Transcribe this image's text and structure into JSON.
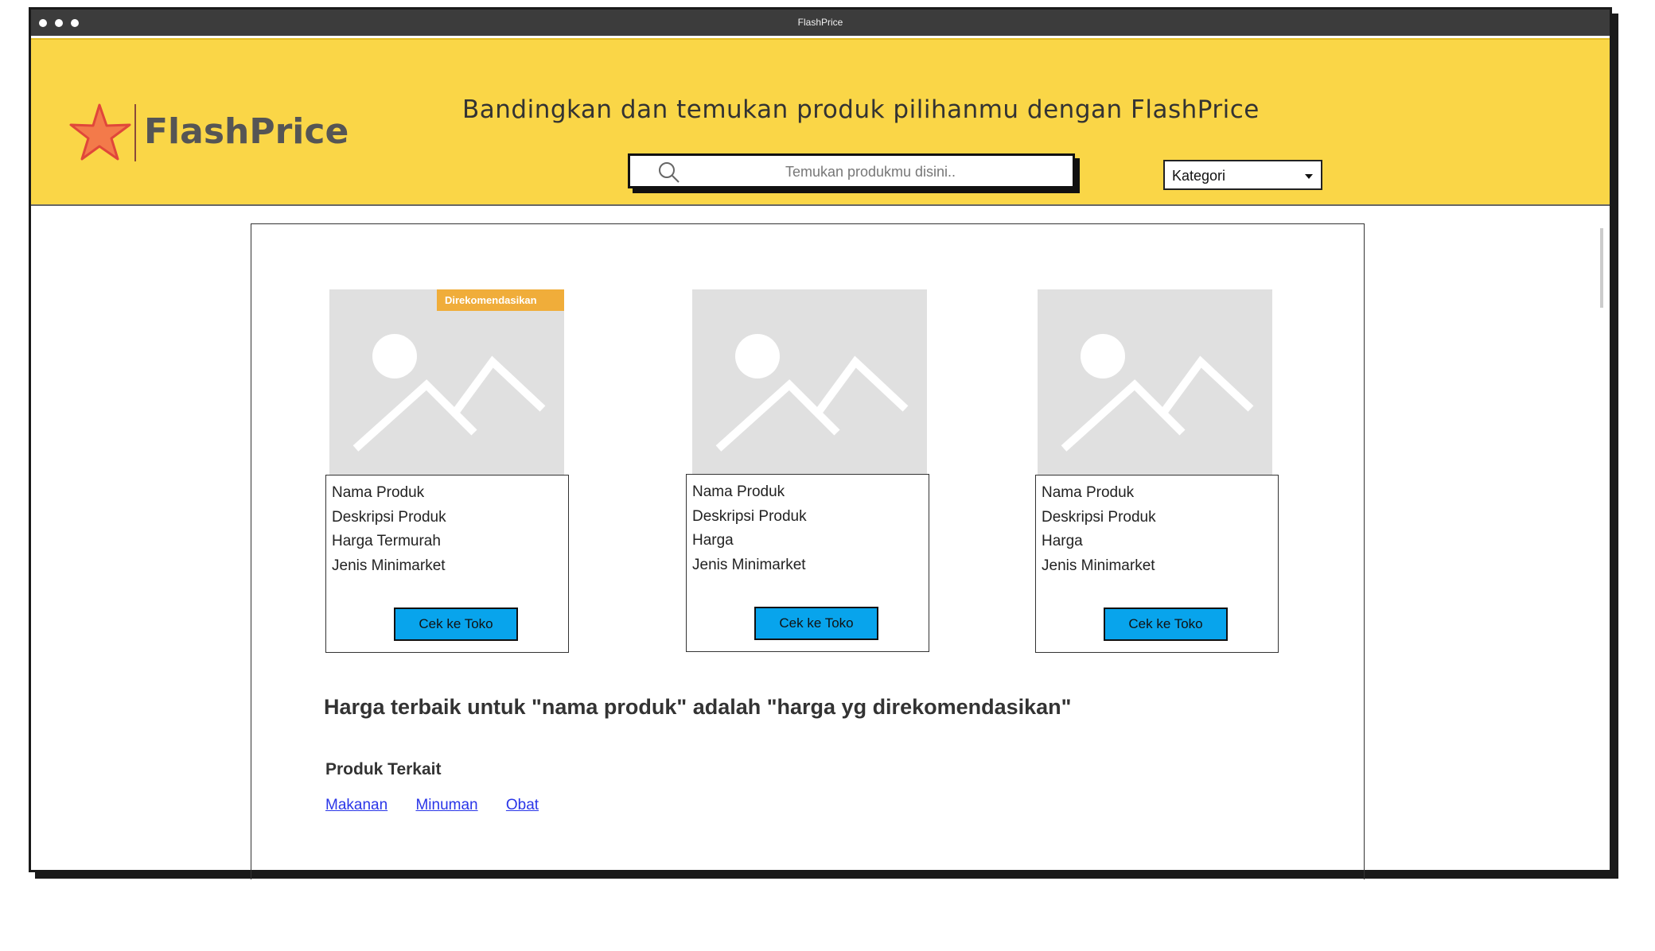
{
  "window": {
    "title": "FlashPrice"
  },
  "header": {
    "logo_text": "FlashPrice",
    "tagline": "Bandingkan dan temukan produk pilihanmu dengan FlashPrice",
    "search_placeholder": "Temukan produkmu disini..",
    "category_label": "Kategori"
  },
  "products": [
    {
      "badge": "Direkomendasikan",
      "name": "Nama Produk",
      "description": "Deskripsi Produk",
      "price": "Harga Termurah",
      "store_type": "Jenis Minimarket",
      "button": "Cek ke Toko"
    },
    {
      "name": "Nama Produk",
      "description": "Deskripsi Produk",
      "price": "Harga",
      "store_type": "Jenis Minimarket",
      "button": "Cek ke Toko"
    },
    {
      "name": "Nama Produk",
      "description": "Deskripsi Produk",
      "price": "Harga",
      "store_type": "Jenis Minimarket",
      "button": "Cek ke Toko"
    }
  ],
  "best_price_text": "Harga terbaik untuk \"nama produk\" adalah \"harga yg direkomendasikan\"",
  "related": {
    "title": "Produk Terkait",
    "links": [
      "Makanan",
      "Minuman",
      "Obat"
    ]
  },
  "colors": {
    "header_bg": "#fad647",
    "button_bg": "#08a4ec",
    "badge_bg": "#f0ad3a",
    "link": "#2a36e8"
  },
  "icons": [
    "star-logo-icon",
    "search-icon",
    "chevron-down-icon",
    "image-placeholder-icon"
  ]
}
